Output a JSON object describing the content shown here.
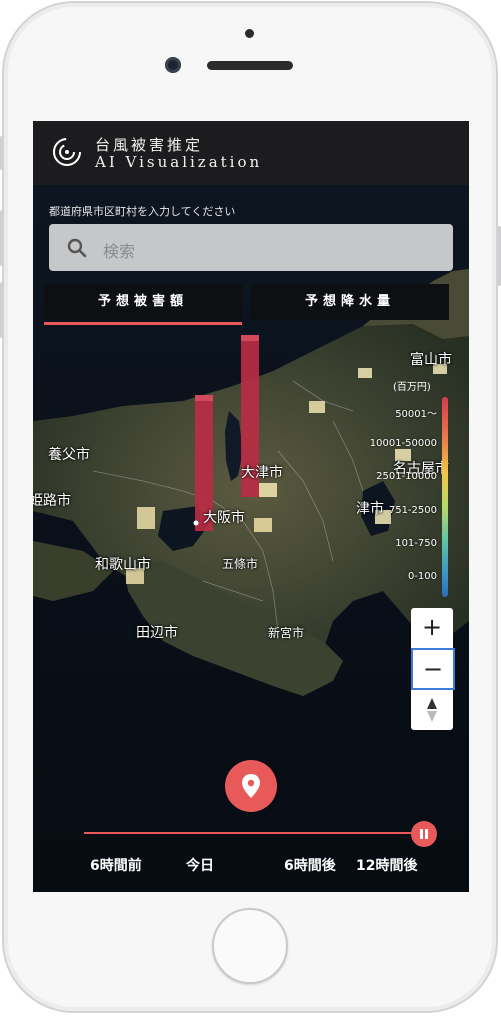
{
  "app": {
    "title_jp": "台風被害推定",
    "title_en": "AI Visualization"
  },
  "search": {
    "label": "都道府県市区町村を入力してください",
    "placeholder": "検索"
  },
  "tabs": [
    {
      "label": "予想被害額",
      "active": true
    },
    {
      "label": "予想降水量",
      "active": false
    }
  ],
  "cities": [
    {
      "name": "富山市"
    },
    {
      "name": "養父市"
    },
    {
      "name": "大津市"
    },
    {
      "name": "名古屋市"
    },
    {
      "name": "姫路市"
    },
    {
      "name": "大阪市"
    },
    {
      "name": "津市"
    },
    {
      "name": "和歌山市"
    },
    {
      "name": "五條市"
    },
    {
      "name": "田辺市"
    },
    {
      "name": "新宮市"
    }
  ],
  "legend": {
    "unit": "(百万円)",
    "levels": [
      "50001〜",
      "10001-50000",
      "2501-10000",
      "751-2500",
      "101-750",
      "0-100"
    ]
  },
  "zoom": {
    "in_label": "+",
    "out_label": "−"
  },
  "timeline": {
    "labels": [
      "6時間前",
      "今日",
      "6時間後",
      "12時間後"
    ],
    "position": 1.0
  },
  "colors": {
    "accent": "#e85a5a",
    "header_bg": "#1c1c1e",
    "bar": "#c9364d",
    "zoom_focus": "#3d7ad9"
  },
  "icons": {
    "logo": "typhoon-logo-icon",
    "search": "search-icon",
    "locate": "location-pin-icon",
    "pause": "pause-icon",
    "compass": "compass-icon"
  }
}
